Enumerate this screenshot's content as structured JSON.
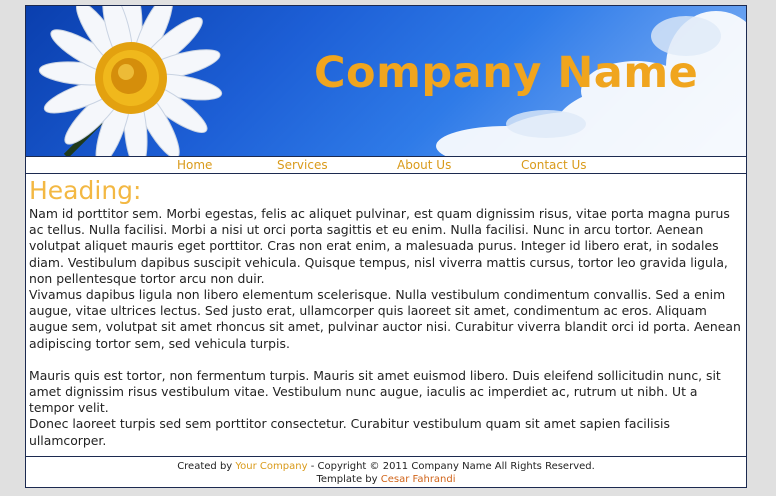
{
  "header": {
    "company_name": "Company Name"
  },
  "nav": {
    "items": [
      {
        "label": "Home"
      },
      {
        "label": "Services"
      },
      {
        "label": "About Us"
      },
      {
        "label": "Contact Us"
      }
    ]
  },
  "main": {
    "heading": "Heading:",
    "paragraphs": [
      "Nam id porttitor sem. Morbi egestas, felis ac aliquet pulvinar, est quam dignissim risus, vitae porta magna purus ac tellus. Nulla facilisi. Morbi a nisi ut orci porta sagittis et eu enim. Nulla facilisi. Nunc in arcu tortor. Aenean volutpat aliquet mauris eget porttitor. Cras non erat enim, a malesuada purus. Integer id libero erat, in sodales diam. Vestibulum dapibus suscipit vehicula. Quisque tempus, nisl viverra mattis cursus, tortor leo gravida ligula, non pellentesque tortor arcu non duir.",
      "Vivamus dapibus ligula non libero elementum scelerisque. Nulla vestibulum condimentum convallis. Sed a enim augue, vitae ultrices lectus. Sed justo erat, ullamcorper quis laoreet sit amet, condimentum ac eros. Aliquam augue sem, volutpat sit amet rhoncus sit amet, pulvinar auctor nisi. Curabitur viverra blandit orci id porta. Aenean adipiscing tortor sem, sed vehicula turpis.",
      "Mauris quis est tortor, non fermentum turpis. Mauris sit amet euismod libero. Duis eleifend sollicitudin nunc, sit amet dignissim risus vestibulum vitae. Vestibulum nunc augue, iaculis ac imperdiet ac, rutrum ut nibh. Ut a tempor velit.",
      "Donec laoreet turpis sed sem porttitor consectetur. Curabitur vestibulum quam sit amet sapien facilisis ullamcorper."
    ]
  },
  "footer": {
    "created_by": "Created by",
    "your_company": "Your Company",
    "copyright": "- Copyright © 2011 Company Name All Rights Reserved.",
    "template_by": "Template by",
    "author": "Cesar Fahrandi"
  },
  "colors": {
    "accent": "#f0a51e",
    "link": "#d99a1a",
    "heading": "#f3b843",
    "border": "#1c2a50",
    "sky": "#1d5fd6"
  }
}
